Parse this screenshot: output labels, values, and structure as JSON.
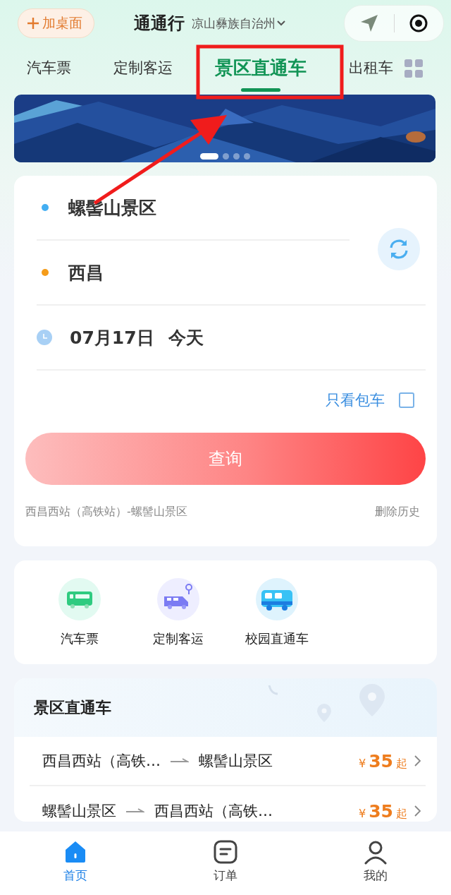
{
  "header": {
    "add_button": "加桌面",
    "title": "通通行",
    "region": "凉山彝族自治州"
  },
  "tabs": [
    {
      "label": "汽车票",
      "selected": false
    },
    {
      "label": "定制客运",
      "selected": false
    },
    {
      "label": "景区直通车",
      "selected": true
    },
    {
      "label": "出租车",
      "selected": false
    }
  ],
  "banner": {
    "dots": [
      {
        "selected": true
      },
      {
        "selected": false
      },
      {
        "selected": false
      },
      {
        "selected": false
      }
    ]
  },
  "search_form": {
    "from": "螺髻山景区",
    "to": "西昌",
    "date": "07月17日",
    "day": "今天",
    "charter_only": {
      "label": "只看包车",
      "checked": false
    },
    "search_button": "查询",
    "history": "西昌西站（高铁站）-螺髻山景区",
    "clear_history": "删除历史"
  },
  "services": [
    {
      "label": "汽车票",
      "kind": "bus"
    },
    {
      "label": "定制客运",
      "kind": "van"
    },
    {
      "label": "校园直通车",
      "kind": "coach"
    }
  ],
  "scenic": {
    "title": "景区直通车",
    "routes": [
      {
        "from": "西昌西站（高铁…",
        "to": "螺髻山景区",
        "currency": "¥",
        "price": "35",
        "suffix": "起"
      },
      {
        "from": "螺髻山景区",
        "to": "西昌西站（高铁…",
        "currency": "¥",
        "price": "35",
        "suffix": "起"
      }
    ]
  },
  "bottom_nav": [
    {
      "label": "首页",
      "kind": "home",
      "selected": true
    },
    {
      "label": "订单",
      "kind": "orders",
      "selected": false
    },
    {
      "label": "我的",
      "kind": "profile",
      "selected": false
    }
  ]
}
